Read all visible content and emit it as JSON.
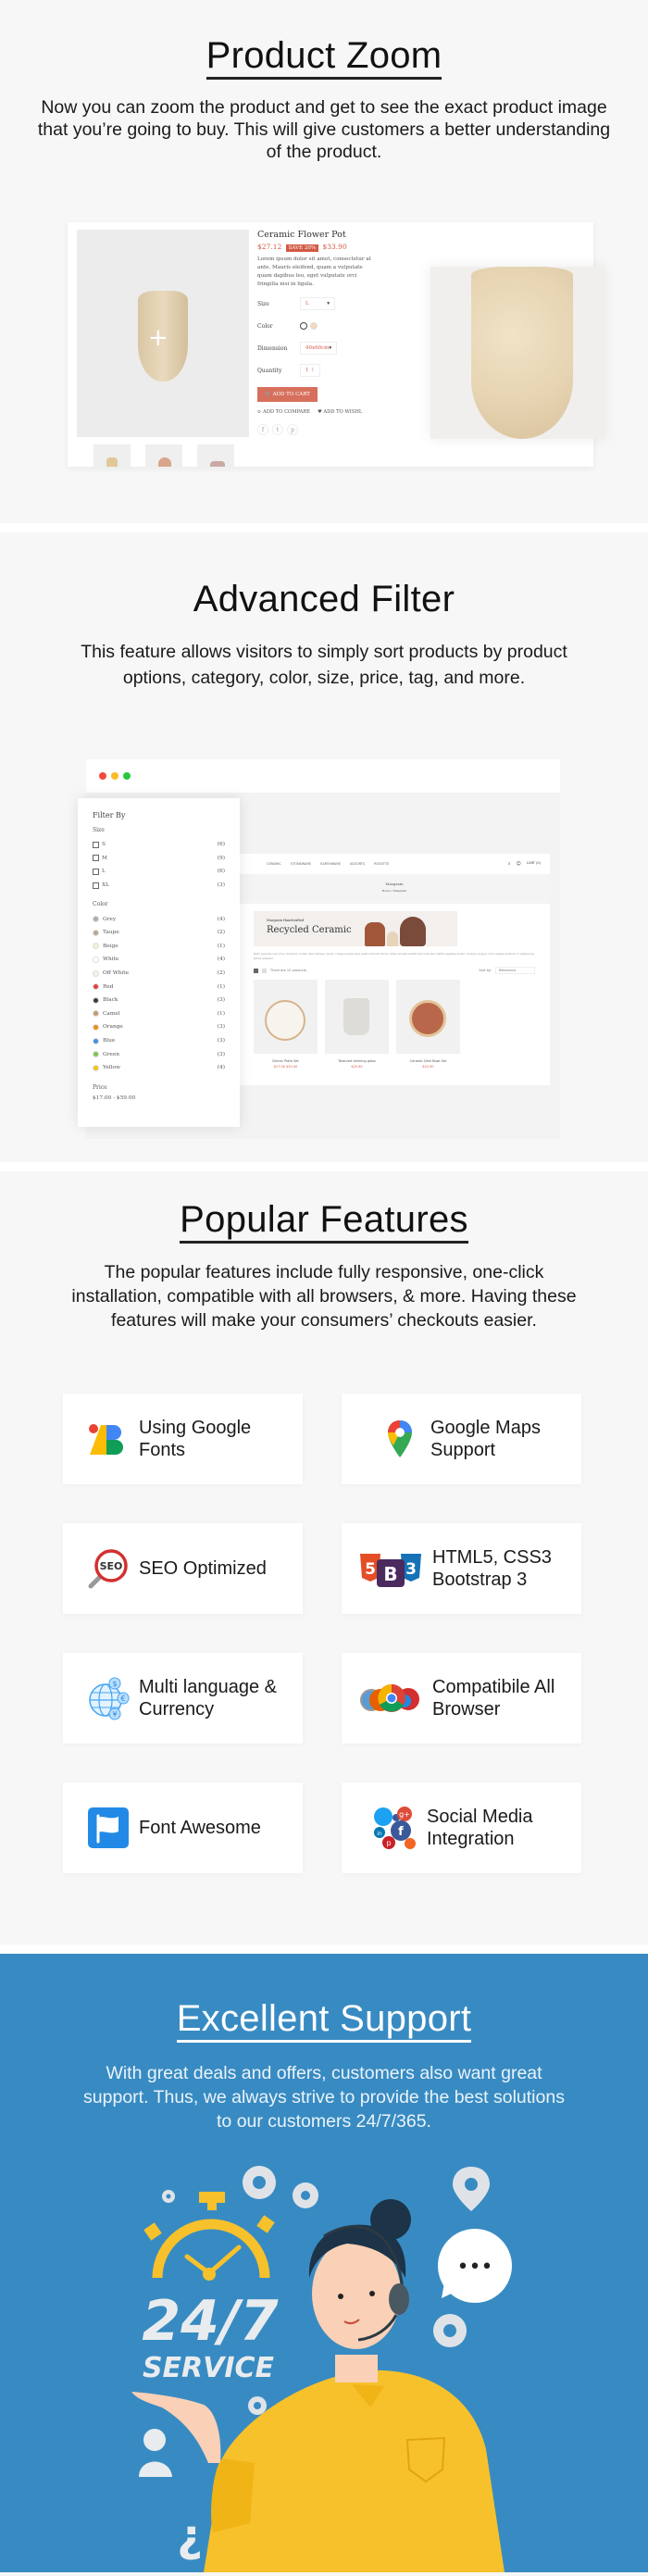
{
  "product_zoom": {
    "title": "Product Zoom",
    "description": "Now you can zoom the product and get to see the exact product image that you’re going to buy. This will give customers a better understanding of the product.",
    "product": {
      "name": "Ceramic Flower Pot",
      "price": "$27.12",
      "badge": "SAVE 20%",
      "old_price": "$33.90",
      "description": "Lorem ipsum dolor sit amet, consectetur at ante. Mauris eleifend, quam a vulputate quam dapibus leo, eget vulputate orci fringilla nisi in ligula.",
      "size_label": "Size",
      "size_value": "L",
      "color_label": "Color",
      "dimension_label": "Dimension",
      "dimension_value": "40x60cm",
      "quantity_label": "Quantity",
      "quantity_value": "1",
      "add_to_cart": "ADD TO CART",
      "add_to_compare": "ADD TO COMPARE",
      "add_to_wishlist": "ADD TO WISHL",
      "social": [
        "f",
        "t",
        "p"
      ],
      "zoom_icon": "+"
    }
  },
  "advanced_filter": {
    "title": "Advanced Filter",
    "description": "This feature allows visitors to simply sort products by product options, category, color, size, price, tag, and more.",
    "browser_dots": [
      "#f44b3c",
      "#f9bd27",
      "#27c93f"
    ],
    "shop": {
      "nav": [
        "CERAMIC",
        "STONEWARE",
        "EARTHWARE",
        "ASSORTS",
        "ROSETTE"
      ],
      "nav_right": [
        "⌕",
        "☺",
        "CART (0)"
      ],
      "crumb_title": "Masgrain",
      "crumb_path": "Home / Masgrain",
      "banner_small": "Masgrain Handcrafted",
      "banner_title": "Recycled Ceramic",
      "intro_text": "Nam gravida nisl urna. Vivamus mollis risus tempor quam congue turpis sed quam blandit donec vitae laoreet vestibulum lobortis mattis egestas lorem conseq congue urna massa pretium in adipiscing tellus aliquam.",
      "count_text": "There are 12 products.",
      "sort_label": "Sort by:",
      "sort_value": "Relevance",
      "products": [
        {
          "name": "Dinner Plate Set",
          "price": "$17.00 $20.00"
        },
        {
          "name": "Textured drinking glass",
          "price": "$25.90"
        },
        {
          "name": "Ceramic Dish Bowl Set",
          "price": "$22.90"
        }
      ]
    },
    "filter": {
      "title": "Filter By",
      "size_heading": "Size",
      "sizes": [
        {
          "label": "S",
          "count": "(6)"
        },
        {
          "label": "M",
          "count": "(9)"
        },
        {
          "label": "L",
          "count": "(6)"
        },
        {
          "label": "XL",
          "count": "(3)"
        }
      ],
      "color_heading": "Color",
      "colors": [
        {
          "label": "Grey",
          "count": "(4)",
          "swatch": "#a8adb5"
        },
        {
          "label": "Taupe",
          "count": "(2)",
          "swatch": "#b8a995"
        },
        {
          "label": "Beige",
          "count": "(1)",
          "swatch": "#f4efd8"
        },
        {
          "label": "White",
          "count": "(4)",
          "swatch": "#ffffff"
        },
        {
          "label": "Off White",
          "count": "(2)",
          "swatch": "#f8f1e4"
        },
        {
          "label": "Red",
          "count": "(1)",
          "swatch": "#e2413a"
        },
        {
          "label": "Black",
          "count": "(3)",
          "swatch": "#363d48"
        },
        {
          "label": "Camel",
          "count": "(1)",
          "swatch": "#c29a6c"
        },
        {
          "label": "Orange",
          "count": "(3)",
          "swatch": "#f28c13"
        },
        {
          "label": "Blue",
          "count": "(3)",
          "swatch": "#4a8fe2"
        },
        {
          "label": "Green",
          "count": "(3)",
          "swatch": "#7dc751"
        },
        {
          "label": "Yellow",
          "count": "(4)",
          "swatch": "#f5c518"
        }
      ],
      "price_heading": "Price",
      "price_range": "$17.00 - $59.00"
    }
  },
  "popular_features": {
    "title": "Popular Features",
    "description": "The popular features include  fully responsive, one-click installation, compatible with all browsers, & more. Having these features will make your consumers’ checkouts easier.",
    "items": [
      {
        "label": "Using Google Fonts",
        "icon": "google-fonts-icon"
      },
      {
        "label": "Google Maps Support",
        "icon": "google-maps-icon"
      },
      {
        "label": "SEO Optimized",
        "icon": "seo-icon"
      },
      {
        "label": "HTML5, CSS3 Bootstrap 3",
        "icon": "html5-css3-bootstrap-icon"
      },
      {
        "label": "Multi language & Currency",
        "icon": "globe-currency-icon"
      },
      {
        "label": "Compatibile All Browser",
        "icon": "browsers-icon"
      },
      {
        "label": "Font Awesome",
        "icon": "font-awesome-flag-icon"
      },
      {
        "label": "Social Media Integration",
        "icon": "social-media-icon"
      }
    ]
  },
  "excellent_support": {
    "title": "Excellent Support",
    "description": "With great deals and offers, customers also want great support. Thus, we always strive to provide the best solutions to our customers 24/7/365.",
    "illustration": {
      "big_text": "24/7",
      "sub_text": "SERVICE",
      "bubble_text": "•••"
    },
    "bg_color": "#388bc2"
  }
}
